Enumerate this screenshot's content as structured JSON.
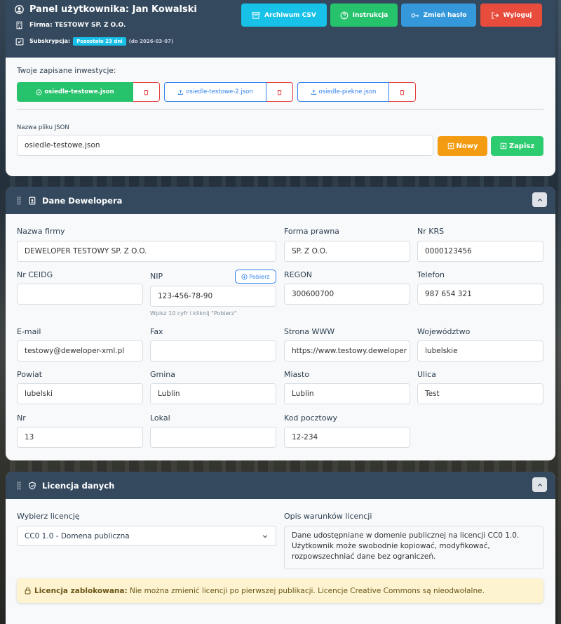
{
  "header": {
    "title": "Panel użytkownika: Jan Kowalski",
    "firm_label": "Firma:",
    "firm_value": "TESTOWY SP. Z O.O.",
    "subscription_label": "Subskrypcja:",
    "subscription_badge": "Pozostało 23 dni",
    "subscription_until": "(do 2026-03-07)",
    "buttons": {
      "archive": "Archiwum CSV",
      "instructions": "Instrukcja",
      "change_password": "Zmień hasło",
      "logout": "Wyloguj"
    }
  },
  "investments": {
    "label": "Twoje zapisane inwestycje:",
    "files": [
      {
        "name": "osiedle-testowe.json",
        "active": true
      },
      {
        "name": "osiedle-testowe-2.json",
        "active": false
      },
      {
        "name": "osiedle-piekne.json",
        "active": false
      }
    ],
    "filename_label": "Nazwa pliku JSON",
    "filename_value": "osiedle-testowe.json",
    "new_button": "Nowy",
    "save_button": "Zapisz"
  },
  "developer": {
    "title": "Dane Dewelopera",
    "fields": {
      "company_name": {
        "label": "Nazwa firmy",
        "value": "DEWELOPER TESTOWY SP. Z O.O."
      },
      "legal_form": {
        "label": "Forma prawna",
        "value": "SP. Z O.O."
      },
      "krs": {
        "label": "Nr KRS",
        "value": "0000123456"
      },
      "ceidg": {
        "label": "Nr CEIDG",
        "value": ""
      },
      "nip": {
        "label": "NIP",
        "value": "123-456-78-90",
        "hint": "Wpisz 10 cyfr i kliknij \"Pobierz\"",
        "fetch_button": "Pobierz"
      },
      "regon": {
        "label": "REGON",
        "value": "300600700"
      },
      "phone": {
        "label": "Telefon",
        "value": "987 654 321"
      },
      "email": {
        "label": "E-mail",
        "value": "testowy@deweloper-xml.pl"
      },
      "fax": {
        "label": "Fax",
        "value": ""
      },
      "www": {
        "label": "Strona WWW",
        "value": "https://www.testowy.deweloper"
      },
      "voivodeship": {
        "label": "Województwo",
        "value": "lubelskie"
      },
      "county": {
        "label": "Powiat",
        "value": "lubelski"
      },
      "commune": {
        "label": "Gmina",
        "value": "Lublin"
      },
      "city": {
        "label": "Miasto",
        "value": "Lublin"
      },
      "street": {
        "label": "Ulica",
        "value": "Test"
      },
      "number": {
        "label": "Nr",
        "value": "13"
      },
      "apartment": {
        "label": "Lokal",
        "value": ""
      },
      "postal_code": {
        "label": "Kod pocztowy",
        "value": "12-234"
      }
    }
  },
  "license": {
    "title": "Licencja danych",
    "select_label": "Wybierz licencję",
    "select_value": "CC0 1.0 - Domena publiczna",
    "terms_label": "Opis warunków licencji",
    "terms_value": "Dane udostępniane w domenie publicznej na licencji CC0 1.0. Użytkownik może swobodnie kopiować, modyfikować, rozpowszechniać dane bez ograniczeń.",
    "alert_bold": "Licencja zablokowana:",
    "alert_text": " Nie można zmienić licencji po pierwszej publikacji. Licencje Creative Commons są nieodwołalne."
  },
  "colors": {
    "header_bg": "#34495e",
    "archive_btn": "#17c1e8",
    "instructions_btn": "#27c26c",
    "password_btn": "#3498db",
    "logout_btn": "#e74c3c",
    "new_btn": "#f39c12",
    "save_btn": "#2ecc71"
  }
}
